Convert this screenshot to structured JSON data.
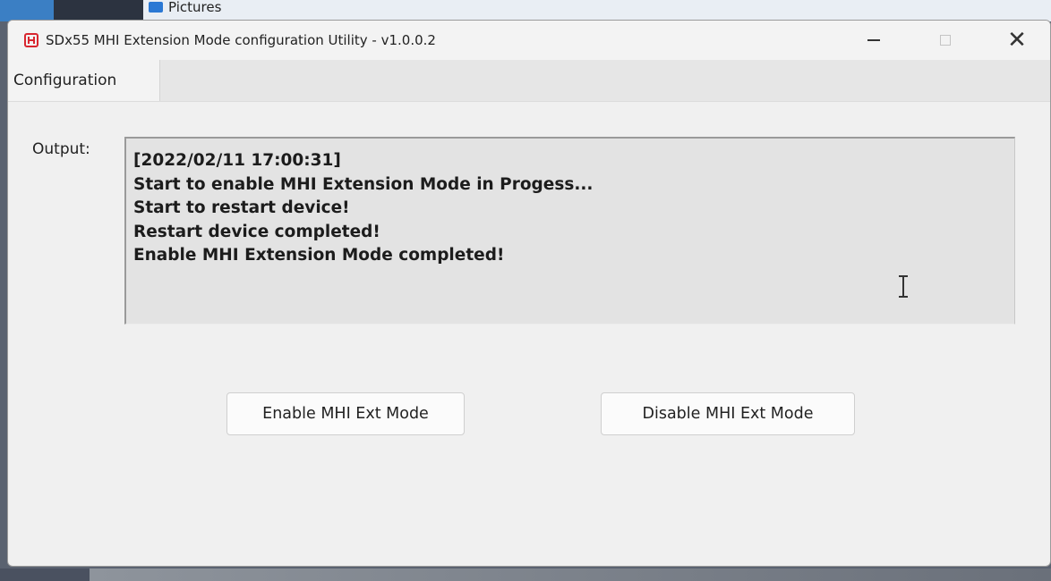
{
  "background": {
    "explorer_item_label": "Pictures"
  },
  "window": {
    "title": "SDx55 MHI Extension Mode configuration Utility - v1.0.0.2",
    "controls": {
      "close_glyph": "✕"
    }
  },
  "tabs": [
    {
      "label": "Configuration",
      "selected": true
    }
  ],
  "output": {
    "label": "Output:",
    "lines": [
      "[2022/02/11 17:00:31]",
      "Start to enable MHI Extension Mode in Progess...",
      "Start to restart device!",
      "Restart device completed!",
      "Enable MHI Extension Mode completed!"
    ]
  },
  "buttons": {
    "enable_label": "Enable MHI Ext Mode",
    "disable_label": "Disable MHI Ext Mode"
  },
  "colors": {
    "app_icon": "#d8262f",
    "window_bg": "#f0f0f0",
    "output_bg": "#e3e3e3"
  },
  "icons": {
    "app": "app-logo-icon",
    "minimize": "minimize-icon",
    "maximize": "maximize-icon",
    "close": "close-icon",
    "text_cursor": "text-cursor-icon"
  }
}
